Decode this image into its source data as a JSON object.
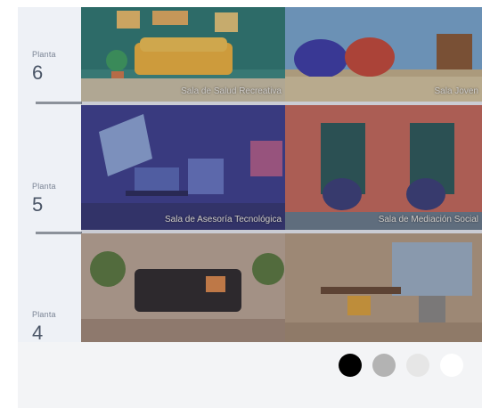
{
  "carousel": {
    "floor_caption": "Planta",
    "floors": [
      {
        "number": "6",
        "rooms": [
          "Sala de Salud Recreativa",
          "Sala Joven"
        ]
      },
      {
        "number": "5",
        "rooms": [
          "Sala de Asesoría Tecnológica",
          "Sala de Mediación Social"
        ]
      },
      {
        "number": "4",
        "rooms": [
          "",
          ""
        ]
      }
    ],
    "pagination": {
      "total": 4,
      "active_index": 0,
      "colors": [
        "#000000",
        "#b3b3b3",
        "#e6e6e6",
        "#ffffff"
      ]
    }
  }
}
